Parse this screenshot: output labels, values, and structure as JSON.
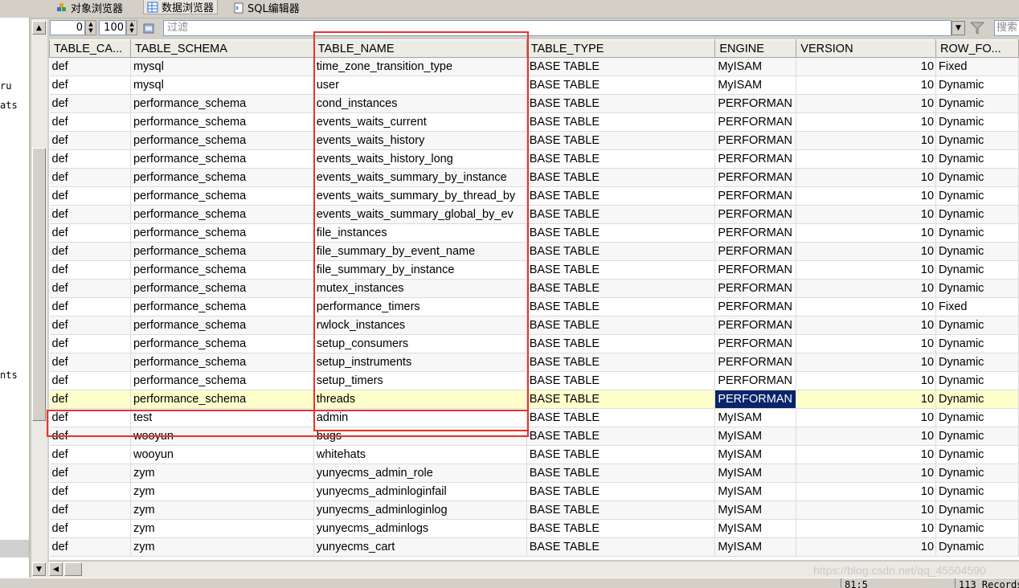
{
  "tabs": [
    {
      "label": "对象浏览器",
      "icon": "object-browser-icon",
      "active": false
    },
    {
      "label": "数据浏览器",
      "icon": "data-browser-icon",
      "active": true
    },
    {
      "label": "SQL编辑器",
      "icon": "sql-editor-icon",
      "active": false
    }
  ],
  "left_panel": {
    "fragments": [
      "ru",
      "ats",
      "nts"
    ]
  },
  "toolbar": {
    "offset_value": "0",
    "limit_value": "100",
    "filter_placeholder": "过滤",
    "search_placeholder": "搜索"
  },
  "grid": {
    "columns": [
      "TABLE_CA...",
      "TABLE_SCHEMA",
      "TABLE_NAME",
      "TABLE_TYPE",
      "ENGINE",
      "VERSION",
      "ROW_FO..."
    ],
    "rows": [
      [
        "def",
        "mysql",
        "time_zone_transition_type",
        "BASE TABLE",
        "MyISAM",
        "10",
        "Fixed"
      ],
      [
        "def",
        "mysql",
        "user",
        "BASE TABLE",
        "MyISAM",
        "10",
        "Dynamic"
      ],
      [
        "def",
        "performance_schema",
        "cond_instances",
        "BASE TABLE",
        "PERFORMAN",
        "10",
        "Dynamic"
      ],
      [
        "def",
        "performance_schema",
        "events_waits_current",
        "BASE TABLE",
        "PERFORMAN",
        "10",
        "Dynamic"
      ],
      [
        "def",
        "performance_schema",
        "events_waits_history",
        "BASE TABLE",
        "PERFORMAN",
        "10",
        "Dynamic"
      ],
      [
        "def",
        "performance_schema",
        "events_waits_history_long",
        "BASE TABLE",
        "PERFORMAN",
        "10",
        "Dynamic"
      ],
      [
        "def",
        "performance_schema",
        "events_waits_summary_by_instance",
        "BASE TABLE",
        "PERFORMAN",
        "10",
        "Dynamic"
      ],
      [
        "def",
        "performance_schema",
        "events_waits_summary_by_thread_by",
        "BASE TABLE",
        "PERFORMAN",
        "10",
        "Dynamic"
      ],
      [
        "def",
        "performance_schema",
        "events_waits_summary_global_by_ev",
        "BASE TABLE",
        "PERFORMAN",
        "10",
        "Dynamic"
      ],
      [
        "def",
        "performance_schema",
        "file_instances",
        "BASE TABLE",
        "PERFORMAN",
        "10",
        "Dynamic"
      ],
      [
        "def",
        "performance_schema",
        "file_summary_by_event_name",
        "BASE TABLE",
        "PERFORMAN",
        "10",
        "Dynamic"
      ],
      [
        "def",
        "performance_schema",
        "file_summary_by_instance",
        "BASE TABLE",
        "PERFORMAN",
        "10",
        "Dynamic"
      ],
      [
        "def",
        "performance_schema",
        "mutex_instances",
        "BASE TABLE",
        "PERFORMAN",
        "10",
        "Dynamic"
      ],
      [
        "def",
        "performance_schema",
        "performance_timers",
        "BASE TABLE",
        "PERFORMAN",
        "10",
        "Fixed"
      ],
      [
        "def",
        "performance_schema",
        "rwlock_instances",
        "BASE TABLE",
        "PERFORMAN",
        "10",
        "Dynamic"
      ],
      [
        "def",
        "performance_schema",
        "setup_consumers",
        "BASE TABLE",
        "PERFORMAN",
        "10",
        "Dynamic"
      ],
      [
        "def",
        "performance_schema",
        "setup_instruments",
        "BASE TABLE",
        "PERFORMAN",
        "10",
        "Dynamic"
      ],
      [
        "def",
        "performance_schema",
        "setup_timers",
        "BASE TABLE",
        "PERFORMAN",
        "10",
        "Dynamic"
      ],
      [
        "def",
        "performance_schema",
        "threads",
        "BASE TABLE",
        "PERFORMAN",
        "10",
        "Dynamic"
      ],
      [
        "def",
        "test",
        "admin",
        "BASE TABLE",
        "MyISAM",
        "10",
        "Dynamic"
      ],
      [
        "def",
        "wooyun",
        "bugs",
        "BASE TABLE",
        "MyISAM",
        "10",
        "Dynamic"
      ],
      [
        "def",
        "wooyun",
        "whitehats",
        "BASE TABLE",
        "MyISAM",
        "10",
        "Dynamic"
      ],
      [
        "def",
        "zym",
        "yunyecms_admin_role",
        "BASE TABLE",
        "MyISAM",
        "10",
        "Dynamic"
      ],
      [
        "def",
        "zym",
        "yunyecms_adminloginfail",
        "BASE TABLE",
        "MyISAM",
        "10",
        "Dynamic"
      ],
      [
        "def",
        "zym",
        "yunyecms_adminloginlog",
        "BASE TABLE",
        "MyISAM",
        "10",
        "Dynamic"
      ],
      [
        "def",
        "zym",
        "yunyecms_adminlogs",
        "BASE TABLE",
        "MyISAM",
        "10",
        "Dynamic"
      ],
      [
        "def",
        "zym",
        "yunyecms_cart",
        "BASE TABLE",
        "MyISAM",
        "10",
        "Dynamic"
      ]
    ],
    "selected_row": 18,
    "selected_col": 4
  },
  "status": {
    "cursor_position": "81:5",
    "record_count": "113 Records"
  },
  "watermark": "https://blog.csdn.net/qq_45504590",
  "colors": {
    "selected_row": "#ffffcc",
    "selected_cell": "#0a246a",
    "annotation_red": "#e8332d"
  }
}
